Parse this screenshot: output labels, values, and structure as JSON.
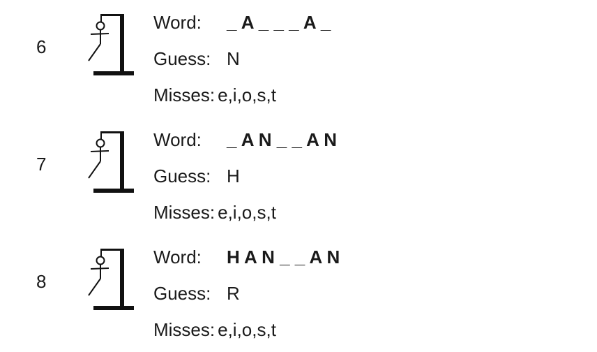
{
  "rounds": [
    {
      "number": "6",
      "word_label": "Word:",
      "word": "_ A _ _ _ A _",
      "guess_label": "Guess:",
      "guess": "N",
      "misses_label": "Misses:",
      "misses": "e,i,o,s,t",
      "gallows_icon": "hangman-gallows-icon"
    },
    {
      "number": "7",
      "word_label": "Word:",
      "word": "_ A N _ _ A N",
      "guess_label": "Guess:",
      "guess": "H",
      "misses_label": "Misses:",
      "misses": "e,i,o,s,t",
      "gallows_icon": "hangman-gallows-icon"
    },
    {
      "number": "8",
      "word_label": "Word:",
      "word": "H A N _ _ A N",
      "guess_label": "Guess:",
      "guess": "R",
      "misses_label": "Misses:",
      "misses": "e,i,o,s,t",
      "gallows_icon": "hangman-gallows-icon"
    }
  ]
}
